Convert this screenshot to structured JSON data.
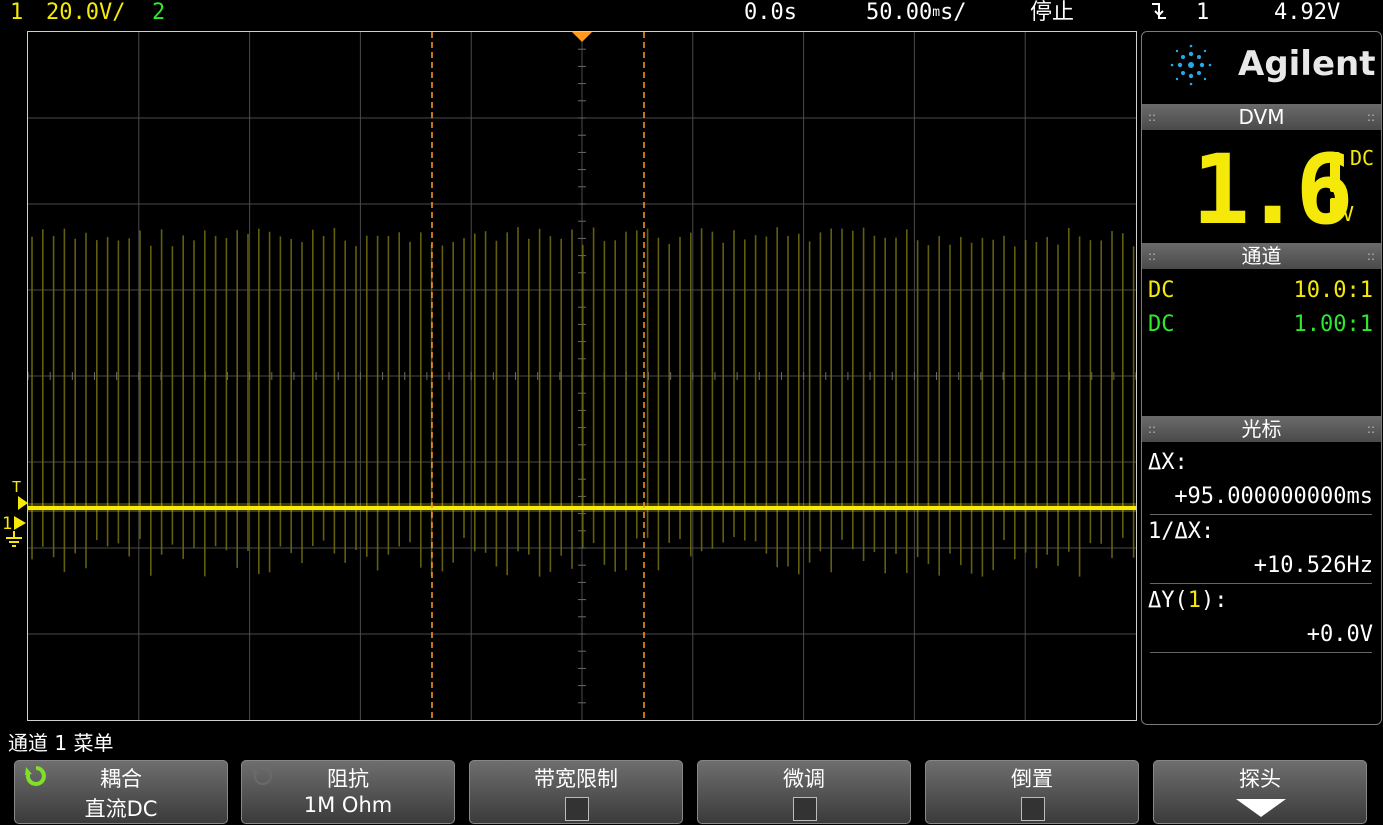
{
  "status_bar": {
    "ch1_num": "1",
    "ch1_scale": "20.0V/",
    "ch2_num": "2",
    "time_delay": "0.0s",
    "time_scale": "50.00",
    "time_scale_unit": "s/",
    "time_scale_prefix": "m",
    "run_state": "停止",
    "trigger_icon": "trigger-falling-edge-icon",
    "trigger_source": "1",
    "trigger_level": "4.92V"
  },
  "display": {
    "ground_marker": "1",
    "trigger_marker": "T",
    "colors": {
      "ch1": "#f5e90a",
      "ch2": "#2ee82e",
      "cursor": "#ff9a1f",
      "grid": "#4a4a4a"
    }
  },
  "panel": {
    "brand": "Agilent",
    "dvm": {
      "title": "DVM",
      "value": "1.6",
      "mode": "DC",
      "unit": "V"
    },
    "channels": {
      "title": "通道",
      "rows": [
        {
          "coupling": "DC",
          "probe": "10.0:1",
          "color": "#f5e90a"
        },
        {
          "coupling": "DC",
          "probe": "1.00:1",
          "color": "#2ee82e"
        }
      ]
    },
    "cursors": {
      "title": "光标",
      "dx_label": "ΔX:",
      "dx_value": "+95.000000000ms",
      "inv_dx_label": "1/ΔX:",
      "inv_dx_value": "+10.526Hz",
      "dy_label": "ΔY(",
      "dy_ch": "1",
      "dy_end": "):",
      "dy_value": "+0.0V"
    }
  },
  "menu": {
    "title": "通道 1 菜单",
    "softkeys": [
      {
        "label": "耦合",
        "value": "直流DC"
      },
      {
        "label": "阻抗",
        "value": "1M Ohm"
      },
      {
        "label": "带宽限制",
        "value": ""
      },
      {
        "label": "微调",
        "value": ""
      },
      {
        "label": "倒置",
        "value": ""
      },
      {
        "label": "探头",
        "value": ""
      }
    ]
  }
}
